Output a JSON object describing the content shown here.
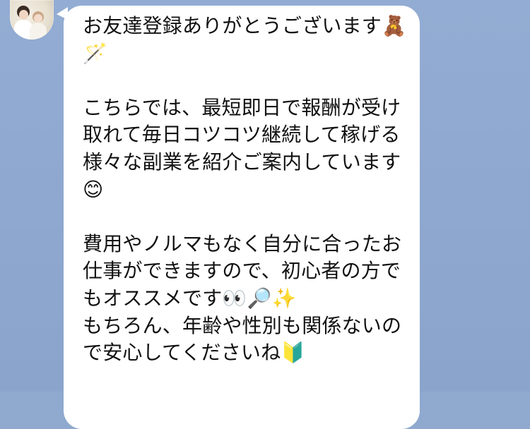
{
  "chat": {
    "background_color": "#8fa9cf",
    "bubble_color": "#ffffff",
    "avatar_icon": "profile-avatar-icon",
    "message_text": "お友達登録ありがとうございます🧸🪄\n\nこちらでは、最短即日で報酬が受け取れて毎日コツコツ継続して稼げる様々な副業を紹介ご案内しています😊\n\n費用やノルマもなく自分に合ったお仕事ができますので、初心者の方でもオススメです👀🔎✨\nもちろん、年齢や性別も関係ないので安心してくださいね🔰"
  }
}
